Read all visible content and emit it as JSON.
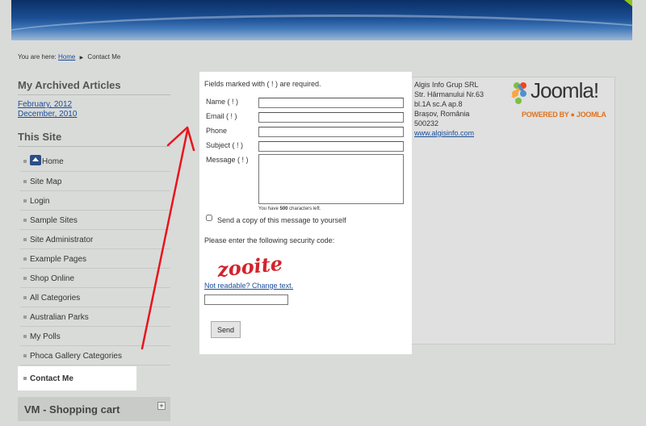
{
  "breadcrumb": {
    "prefix": "You are here:",
    "home": "Home",
    "separator": "▶",
    "current": "Contact Me"
  },
  "sidebar": {
    "archive_title": "My Archived Articles",
    "archive_links": [
      "February, 2012",
      "December, 2010"
    ],
    "site_title": "This Site",
    "menu": [
      {
        "label": "Home",
        "icon": "home-icon"
      },
      {
        "label": "Site Map"
      },
      {
        "label": "Login"
      },
      {
        "label": "Sample Sites"
      },
      {
        "label": "Site Administrator"
      },
      {
        "label": "Example Pages"
      },
      {
        "label": "Shop Online"
      },
      {
        "label": "All Categories"
      },
      {
        "label": "Australian Parks"
      },
      {
        "label": "My Polls"
      },
      {
        "label": "Phoca Gallery Categories"
      },
      {
        "label": "Contact Me",
        "active": true
      }
    ],
    "cart_title": "VM - Shopping cart",
    "cart_toggle": "+"
  },
  "form": {
    "required_note": "Fields marked with ( ! ) are required.",
    "name_label": "Name  ( ! )",
    "email_label": "Email  ( ! )",
    "phone_label": "Phone",
    "subject_label": "Subject  ( ! )",
    "message_label": "Message  ( ! )",
    "chars_left_prefix": "You have ",
    "chars_left_count": "500",
    "chars_left_suffix": " characters left.",
    "copy_label": "Send a copy of this message to yourself",
    "security_label": "Please enter the following security code:",
    "captcha_text": "zooite",
    "change_text": "Not readable? Change text.",
    "send_label": "Send"
  },
  "address": {
    "lines": [
      "Algis Info Grup SRL",
      "Str. Hârmanului Nr.63",
      "bl.1A sc.A ap.8",
      "Brașov, România",
      "500232"
    ],
    "url": "www.algisinfo.com"
  },
  "logo": {
    "word": "Joomla!",
    "tagline": "POWERED BY ● JOOMLA"
  },
  "colors": {
    "link": "#1a4c9a",
    "annotation_arrow": "#e8141b",
    "joomla_orange": "#e0731f"
  }
}
